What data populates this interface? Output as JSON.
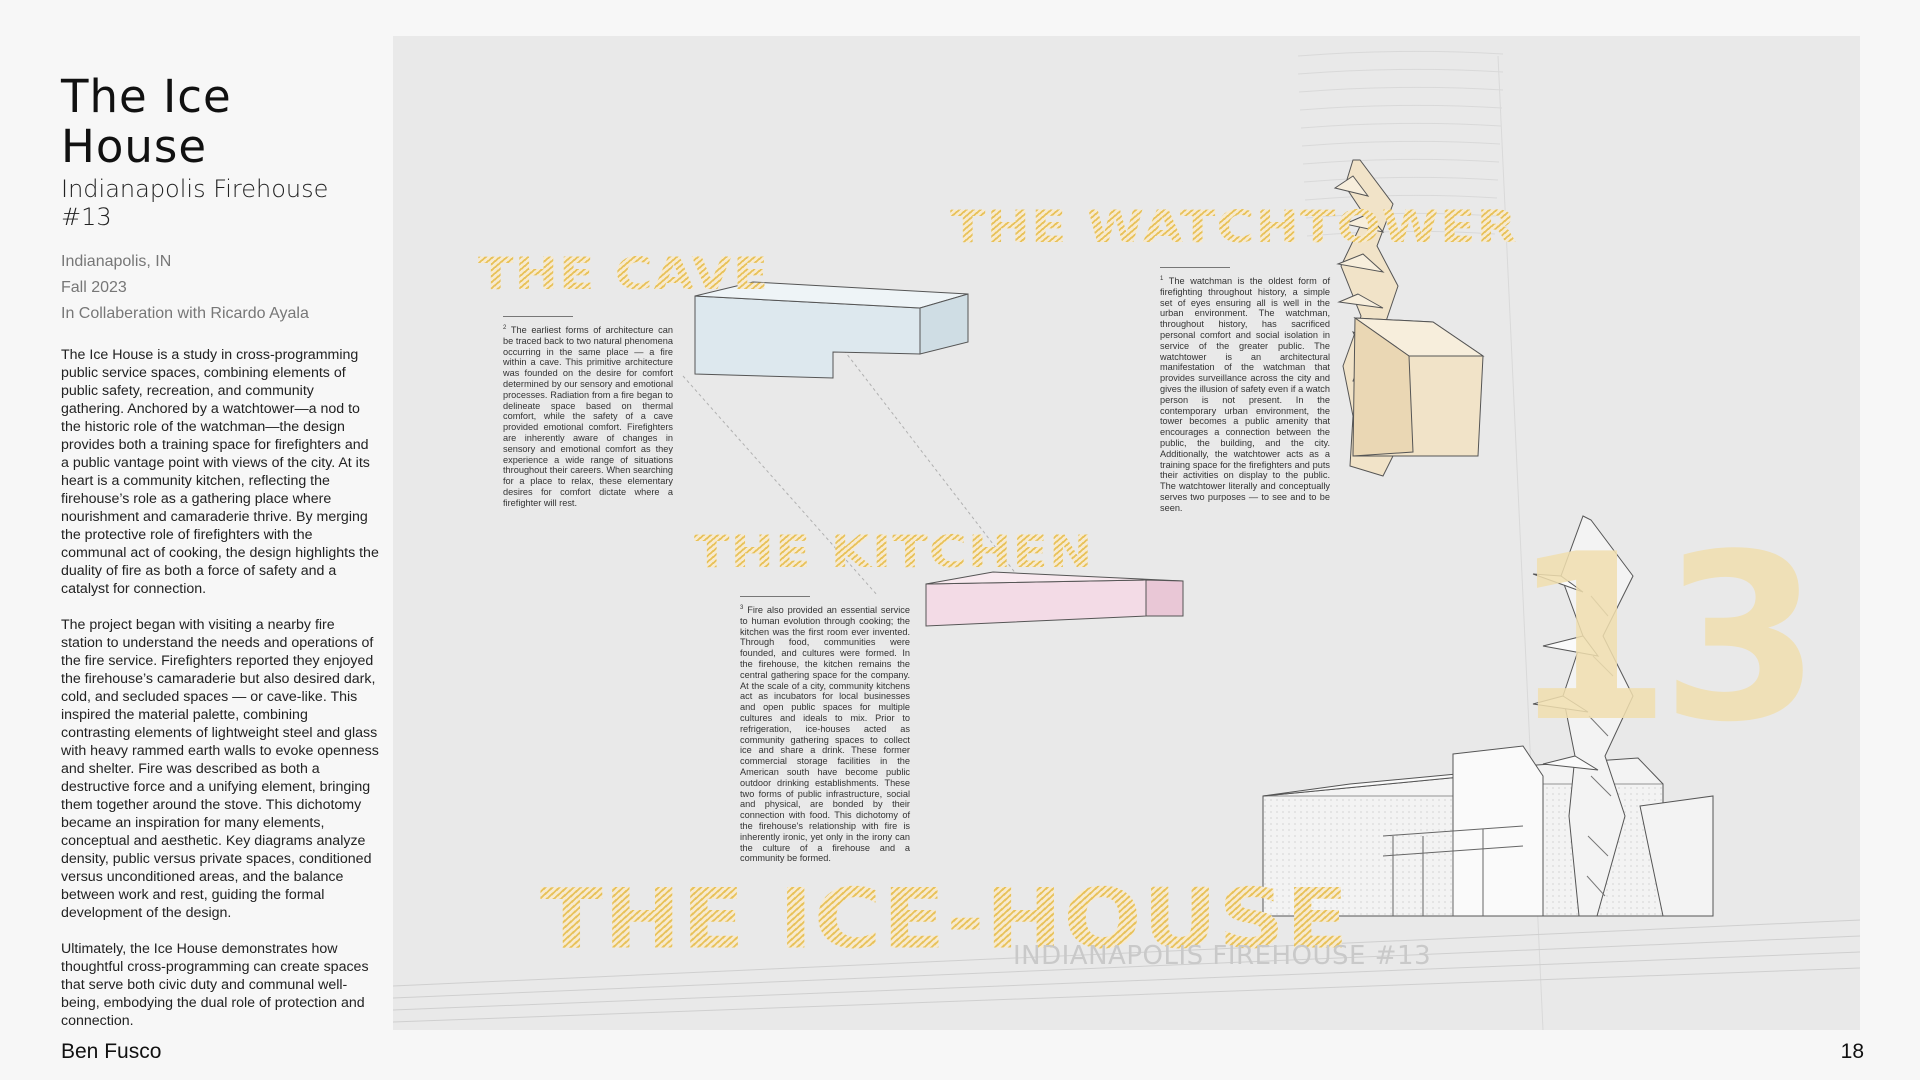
{
  "header": {
    "title": "The Ice House",
    "subtitle": "Indianapolis Firehouse #13",
    "location": "Indianapolis, IN",
    "term": "Fall 2023",
    "collaboration": "In Collaberation with Ricardo Ayala"
  },
  "body": {
    "para1": "The Ice House is a study in cross-programming public service spaces, combining elements of public safety, recreation, and community gathering. Anchored by a watchtower—a nod to the historic role of the watchman—the design provides both a training space for firefighters and a public vantage point with views of the city. At its heart is a community kitchen, reflecting the firehouse’s role as a gathering place where nourishment and camaraderie thrive. By merging the protective role of firefighters with the communal act of cooking, the design highlights the duality of fire as both a force of safety and a catalyst for connection.",
    "para2": "The project began with visiting a nearby fire station to understand the needs and operations of the fire service. Firefighters reported they enjoyed the firehouse’s camaraderie but also desired dark, cold, and secluded spaces — or cave-like. This inspired the material palette, combining contrasting elements of lightweight steel and glass with heavy rammed earth walls to evoke openness and shelter. Fire was described as both a destructive force and a unifying element, bringing them together around the stove. This dichotomy became an inspiration for many elements, conceptual and aesthetic. Key diagrams analyze density, public versus private spaces, conditioned versus unconditioned areas, and the balance between work and rest, guiding the formal development of the design.",
    "para3": "Ultimately, the Ice House demonstrates how thoughtful cross-programming can create spaces that serve both civic duty and communal well-being, embodying the dual role of protection and connection."
  },
  "board": {
    "label_cave": "THE CAVE",
    "label_watchtower": "THE WATCHTOWER",
    "label_kitchen": "THE KITCHEN",
    "label_icehouse": "THE ICE-HOUSE",
    "big_number": "13",
    "subtitle": "INDIANAPOLIS FIREHOUSE #13",
    "note_cave_num": "2",
    "note_cave": "The earliest forms of architecture can be traced back to two natural phenomena occurring in the same place — a fire within a cave. This primitive architecture was founded on the desire for comfort determined by our sensory and emotional processes. Radiation from a fire began to delineate space based on thermal comfort, while the safety of a cave provided emotional comfort. Firefighters are inherently aware of changes in sensory and emotional comfort as they experience a wide range of situations throughout their careers. When searching for a place to relax, these elementary desires for comfort dictate where a firefighter will rest.",
    "note_watchtower_num": "1",
    "note_watchtower": "The watchman is the oldest form of firefighting throughout history, a simple set of eyes ensuring all is well in the urban environment. The watchman, throughout history, has sacrificed personal comfort and social isolation in service of the greater public. The watchtower is an architectural manifestation of the watchman that provides surveillance across the city and gives the illusion of safety even if a watch person is not present. In the contemporary urban environment, the tower becomes a public amenity that encourages a connection between the public, the building, and the city. Additionally, the watchtower acts as a training space for the firefighters and puts their activities on display to the public. The watchtower literally and conceptually serves two purposes — to see and to be seen.",
    "note_kitchen_num": "3",
    "note_kitchen": "Fire also provided an essential service to human evolution through cooking; the kitchen was the first room ever invented. Through food, communities were founded, and cultures were formed. In the firehouse, the kitchen remains the central gathering space for the company. At the scale of a city, community kitchens act as incubators for local businesses and open public spaces for multiple cultures and ideals to mix. Prior to refrigeration, ice-houses acted as community gathering spaces to collect ice and share a drink. These former commercial storage facilities in the American south have become public outdoor drinking establishments. These two forms of public infrastructure, social and physical, are bonded by their connection with food. This dichotomy of the firehouse's relationship with fire is inherently ironic, yet only in the irony can the culture of a firehouse and a community be formed."
  },
  "footer": {
    "author": "Ben Fusco",
    "page_number": "18"
  },
  "colors": {
    "accent_yellow": "#f0d27f",
    "cave_blue": "#dde8ee",
    "kitchen_pink": "#f3dbe6",
    "tower_beige": "#f1e3c8"
  }
}
